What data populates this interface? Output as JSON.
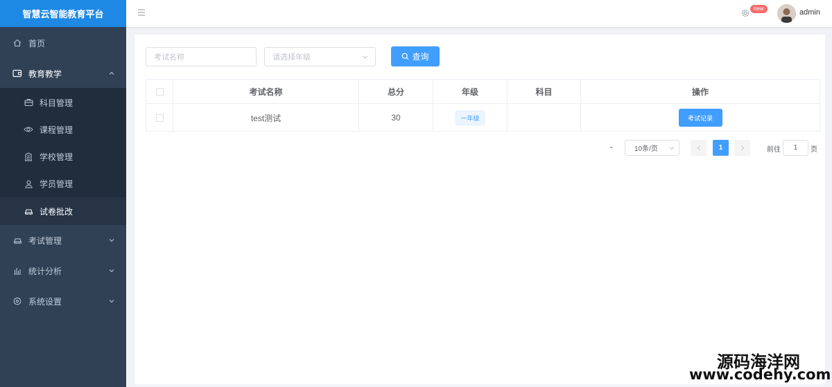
{
  "brand": {
    "title": "智慧云智能教育平台"
  },
  "sidebar": {
    "items": [
      {
        "label": "首页",
        "icon": "home-icon"
      },
      {
        "label": "教育教学",
        "icon": "wallet-icon",
        "open": true,
        "children": [
          {
            "label": "科目管理",
            "icon": "briefcase-icon"
          },
          {
            "label": "课程管理",
            "icon": "eye-icon"
          },
          {
            "label": "学校管理",
            "icon": "building-icon"
          },
          {
            "label": "学员管理",
            "icon": "user-card-icon"
          },
          {
            "label": "试卷批改",
            "icon": "car-icon",
            "active": true
          }
        ]
      },
      {
        "label": "考试管理",
        "icon": "car-icon"
      },
      {
        "label": "统计分析",
        "icon": "bar-chart-icon"
      },
      {
        "label": "系统设置",
        "icon": "setting-icon"
      }
    ]
  },
  "header": {
    "badge": "new",
    "username": "admin"
  },
  "filters": {
    "exam_name_placeholder": "考试名称",
    "grade_placeholder": "请选择年级",
    "search_label": "查询"
  },
  "table": {
    "headers": [
      "考试名称",
      "总分",
      "年级",
      "科目",
      "操作"
    ],
    "rows": [
      {
        "name": "test测试",
        "score": "30",
        "grade": "一年级",
        "subject": "",
        "action": "考试记录"
      }
    ]
  },
  "pagination": {
    "total_mark": "⌄",
    "page_size": "10条/页",
    "current_page": "1",
    "goto_prefix": "前往",
    "goto_value": "1",
    "goto_suffix": "页"
  },
  "watermark": {
    "line1": "源码海洋网",
    "line2": "www.codehy.com"
  },
  "colors": {
    "sidebar_bg": "#304156",
    "brand_bg": "#1e88e5",
    "primary": "#409eff",
    "badge": "#f56c6c"
  }
}
